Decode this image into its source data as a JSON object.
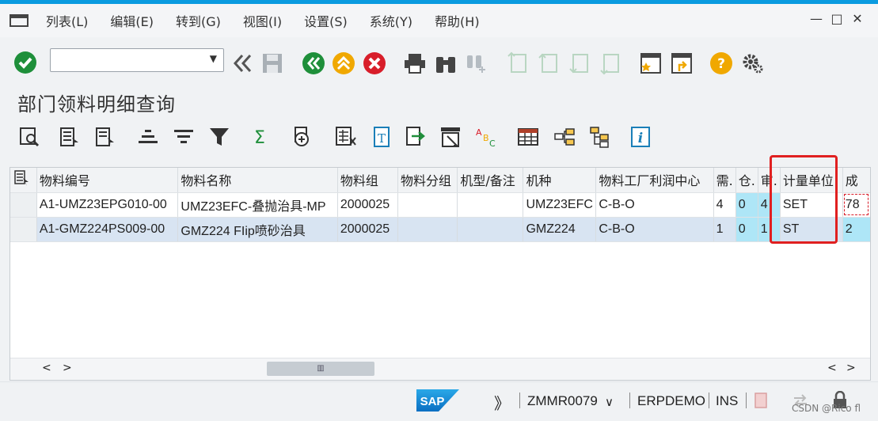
{
  "menu": [
    "列表(L)",
    "编辑(E)",
    "转到(G)",
    "视图(I)",
    "设置(S)",
    "系统(Y)",
    "帮助(H)"
  ],
  "window_controls": [
    "—",
    "□",
    "✕"
  ],
  "command_field": {
    "value": ""
  },
  "page_title": "部门领料明细查询",
  "grid": {
    "columns": [
      "物料编号",
      "物料名称",
      "物料组",
      "物料分组",
      "机型/备注",
      "机种",
      "物料工厂利润中心",
      "需.",
      "仓.",
      "审.",
      "计量单位",
      "成"
    ],
    "rows": [
      [
        "A1-UMZ23EPG010-00",
        "UMZ23EFC-叠抛治具-MP",
        "2000025",
        "",
        "",
        "UMZ23EFC",
        "C-B-O",
        "4",
        "0",
        "4",
        "SET",
        "78"
      ],
      [
        "A1-GMZ224PS009-00",
        "GMZ224 FIip喷砂治具",
        "2000025",
        "",
        "",
        "GMZ224",
        "C-B-O",
        "1",
        "0",
        "1",
        "ST",
        "2"
      ]
    ]
  },
  "scroll": {
    "left_arrow": "<",
    "right_arrow": ">",
    "thumb": "▥"
  },
  "status": {
    "brand": "SAP",
    "expand": "》",
    "transaction": "ZMMR0079",
    "dropdown": "∨",
    "system": "ERPDEMO",
    "mode": "INS"
  },
  "watermark": "CSDN @Rico fl",
  "colors": {
    "accent": "#0a9be0",
    "red_box": "#e02020",
    "selected_row": "#d8e4f2",
    "highlight_cell": "#aee6f7"
  }
}
